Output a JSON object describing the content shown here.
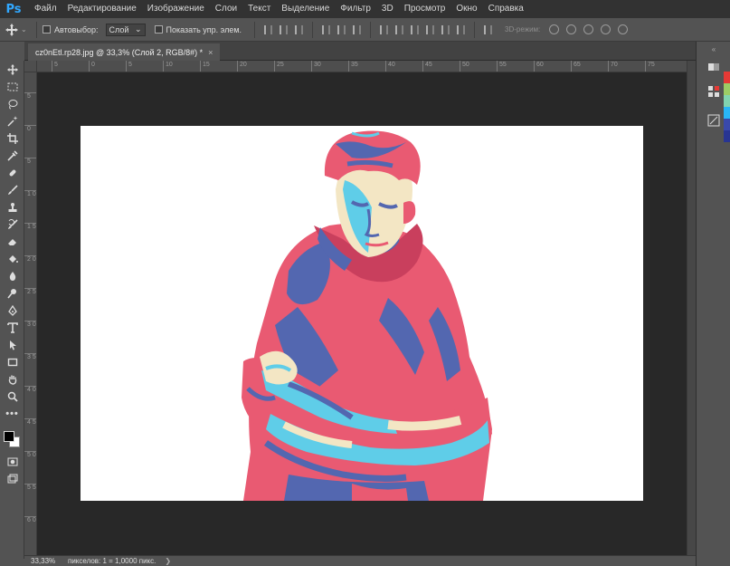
{
  "app": {
    "logo_text": "Ps"
  },
  "menu": [
    "Файл",
    "Редактирование",
    "Изображение",
    "Слои",
    "Текст",
    "Выделение",
    "Фильтр",
    "3D",
    "Просмотр",
    "Окно",
    "Справка"
  ],
  "options": {
    "autoselect_label": "Автовыбор:",
    "layer_select_value": "Слой",
    "show_controls_label": "Показать упр. элем.",
    "mode_3d_label": "3D-режим:"
  },
  "document": {
    "tab_title": "cz0nEtl.rp28.jpg @ 33,3% (Слой 2, RGB/8#) *",
    "close_glyph": "×"
  },
  "rulers": {
    "horizontal": [
      "5",
      "0",
      "5",
      "10",
      "15",
      "20",
      "25",
      "30",
      "35",
      "40",
      "45",
      "50",
      "55",
      "60",
      "65",
      "70",
      "75"
    ],
    "vertical": [
      "5",
      "0",
      "5",
      "1 0",
      "1 5",
      "2 0",
      "2 5",
      "3 0",
      "3 5",
      "4 0",
      "4 5",
      "5 0",
      "5 5",
      "6 0"
    ]
  },
  "status": {
    "zoom": "33,33%",
    "info": "пикселов: 1 = 1,0000 пикс.",
    "arrow": "❯"
  },
  "tools": [
    "move-tool",
    "marquee-tool",
    "lasso-tool",
    "quick-selection-tool",
    "crop-tool",
    "eyedropper-tool",
    "healing-brush-tool",
    "brush-tool",
    "clone-stamp-tool",
    "history-brush-tool",
    "eraser-tool",
    "paint-bucket-tool",
    "blur-tool",
    "dodge-tool",
    "pen-tool",
    "type-tool",
    "path-selection-tool",
    "rectangle-tool",
    "hand-tool",
    "zoom-tool",
    "more-tools"
  ],
  "colors": {
    "foreground": "#000000",
    "background": "#ffffff",
    "accent_pink": "#e95a72",
    "accent_blue": "#5367b0",
    "accent_cyan": "#5fcde8",
    "accent_cream": "#f3e6c4"
  },
  "swatches": [
    "#e53935",
    "#9ccc65",
    "#81d4b0",
    "#29b6f6",
    "#3949ab",
    "#283593"
  ]
}
